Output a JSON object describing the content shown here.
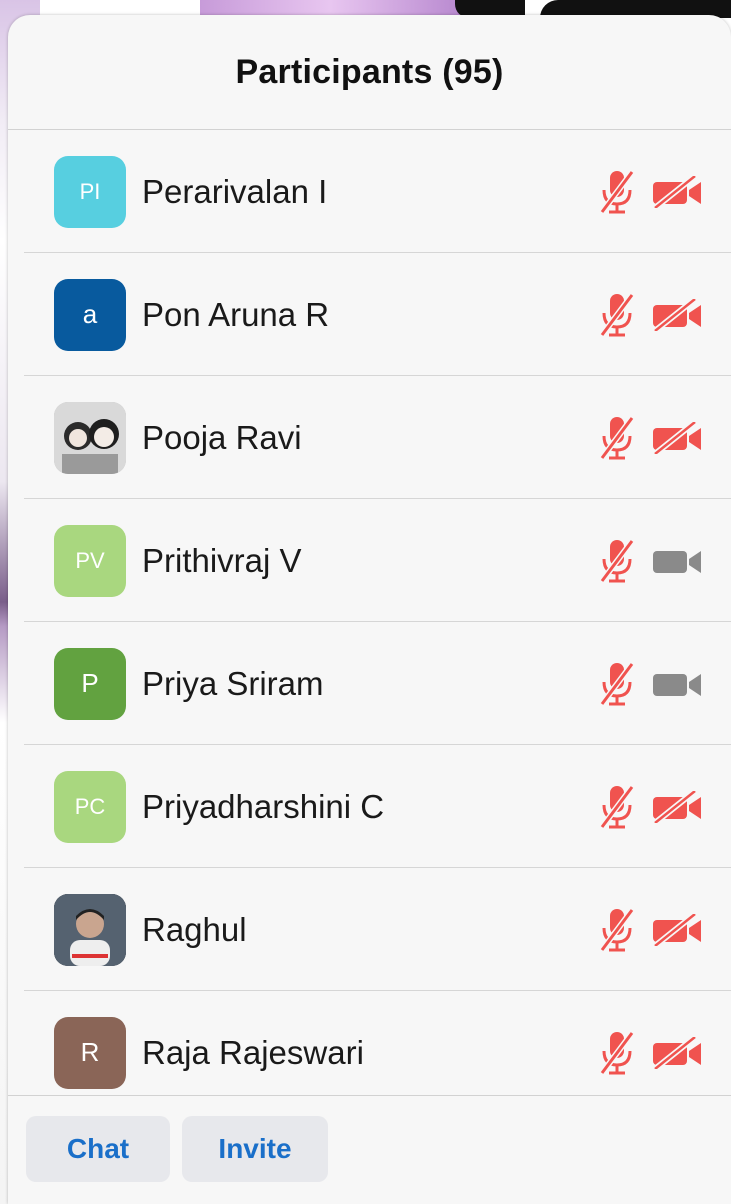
{
  "header": {
    "title": "Participants (95)"
  },
  "colors": {
    "muted_red": "#f0534f",
    "video_on_gray": "#8a8a8a",
    "link_blue": "#1a6fc9"
  },
  "participants": [
    {
      "initials": "PI",
      "name": "Perarivalan I",
      "avatar_color": "#57cfe0",
      "avatar_type": "initials",
      "mic": "muted",
      "video": "off"
    },
    {
      "initials": "a",
      "name": "Pon Aruna R",
      "avatar_color": "#085a9e",
      "avatar_type": "initials",
      "mic": "muted",
      "video": "off"
    },
    {
      "initials": "",
      "name": "Pooja Ravi",
      "avatar_color": "#bdbdbd",
      "avatar_type": "photo",
      "mic": "muted",
      "video": "off"
    },
    {
      "initials": "PV",
      "name": "Prithivraj V",
      "avatar_color": "#a9d77f",
      "avatar_type": "initials",
      "mic": "muted",
      "video": "on"
    },
    {
      "initials": "P",
      "name": "Priya Sriram",
      "avatar_color": "#62a240",
      "avatar_type": "initials",
      "mic": "muted",
      "video": "on"
    },
    {
      "initials": "PC",
      "name": "Priyadharshini C",
      "avatar_color": "#a9d77f",
      "avatar_type": "initials",
      "mic": "muted",
      "video": "off"
    },
    {
      "initials": "",
      "name": "Raghul",
      "avatar_color": "#4a4a4a",
      "avatar_type": "photo",
      "mic": "muted",
      "video": "off"
    },
    {
      "initials": "R",
      "name": "Raja Rajeswari",
      "avatar_color": "#8a6557",
      "avatar_type": "initials",
      "mic": "muted",
      "video": "off"
    }
  ],
  "footer": {
    "chat_label": "Chat",
    "invite_label": "Invite"
  }
}
